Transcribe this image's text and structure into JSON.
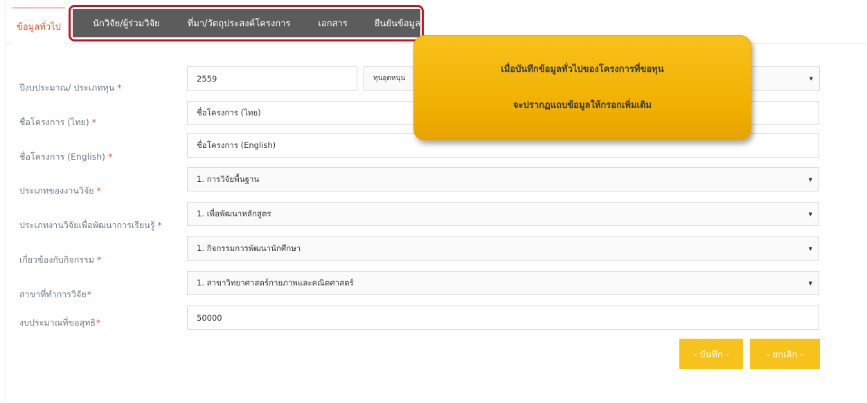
{
  "tabs": {
    "active": "ข้อมูลทั่วไป",
    "items": [
      "นักวิจัย/ผู้ร่วมวิจัย",
      "ที่มา/วัตถุประสงค์โครงการ",
      "เอกสาร",
      "ยืนยันข้อมูล"
    ]
  },
  "form": {
    "required_mark": "*",
    "budget_year": {
      "label": "ปีงบประมาณ/ ประเภททุน",
      "year_value": "2559",
      "fund_type_value": "ทุนอุดหนุน"
    },
    "project_name_th": {
      "label": "ชื่อโครงการ (ไทย)",
      "value": "ชื่อโครงการ (ไทย)"
    },
    "project_name_en": {
      "label": "ชื่อโครงการ (English)",
      "value": "ชื่อโครงการ (English)"
    },
    "research_type": {
      "label": "ประเภทของงานวิจัย",
      "value": "1. การวิจัยพื้นฐาน"
    },
    "learning_research_type": {
      "label": "ประเภทงานวิจัยเพื่อพัฒนาการเรียนรู้",
      "value": "1. เพื่อพัฒนาหลักสูตร"
    },
    "related_activity": {
      "label": "เกี่ยวข้องกับกิจกรรม",
      "value": "1. กิจกรรมการพัฒนานักศึกษา"
    },
    "research_field": {
      "label": "สาขาที่ทำการวิจัย",
      "value": "1. สาขาวิทยาศาสตร์กายภาพและคณิตศาสตร์"
    },
    "net_budget": {
      "label": "งบประมาณที่ขอสุทธิ",
      "value": "50000"
    }
  },
  "tooltip": {
    "line1": "เมื่อบันทึกข้อมูลทั่วไปของโครงการที่ขอทุน",
    "line2": "จะปรากฏแถบข้อมูลให้กรอกเพิ่มเติม"
  },
  "buttons": {
    "save_label": "- บันทึก -",
    "cancel_label": "- ยกเลิก -"
  },
  "colors": {
    "accent": "#e0502c",
    "highlight_border": "#c8121e",
    "tab_bar": "#5c5c5c",
    "button": "#f7c21b",
    "tooltip": "#f5b80f"
  }
}
